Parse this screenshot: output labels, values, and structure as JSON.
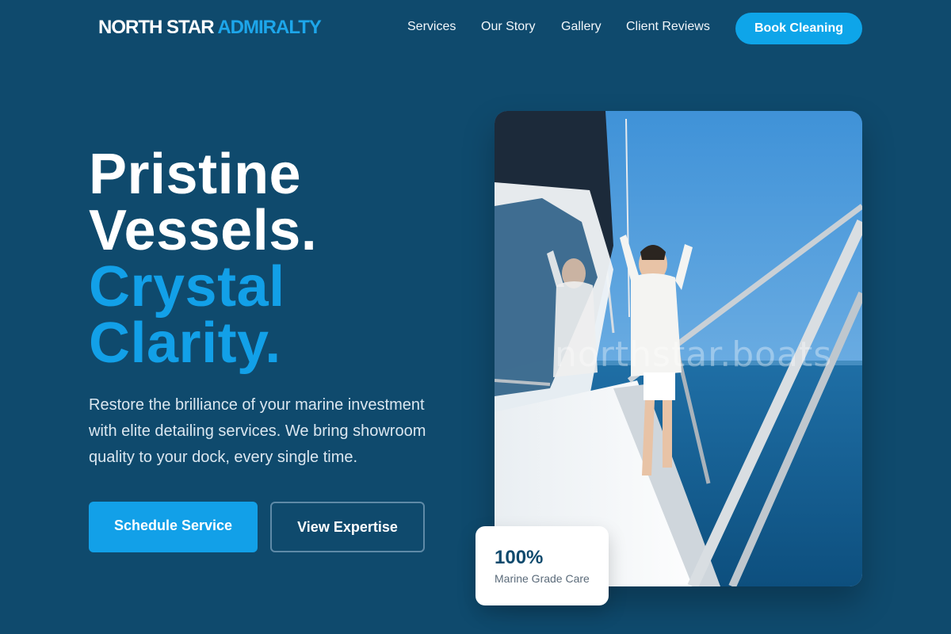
{
  "brand": {
    "name_part1": "NORTH STAR",
    "name_part2": "ADMIRALTY"
  },
  "nav": {
    "links": [
      "Services",
      "Our Story",
      "Gallery",
      "Client Reviews"
    ],
    "cta": "Book Cleaning"
  },
  "hero": {
    "title_lines": [
      "Pristine",
      "Vessels."
    ],
    "title_accent_lines": [
      "Crystal",
      "Clarity."
    ],
    "description": "Restore the brilliance of your marine investment with elite detailing services. We bring showroom quality to your dock, every single time.",
    "primary_button": "Schedule Service",
    "secondary_button": "View Expertise"
  },
  "image": {
    "watermark": "northstar.boats"
  },
  "stat": {
    "value": "100%",
    "label": "Marine Grade Care"
  },
  "colors": {
    "background": "#0f4a6d",
    "accent": "#12a0e8",
    "button": "#0ea5e9"
  }
}
